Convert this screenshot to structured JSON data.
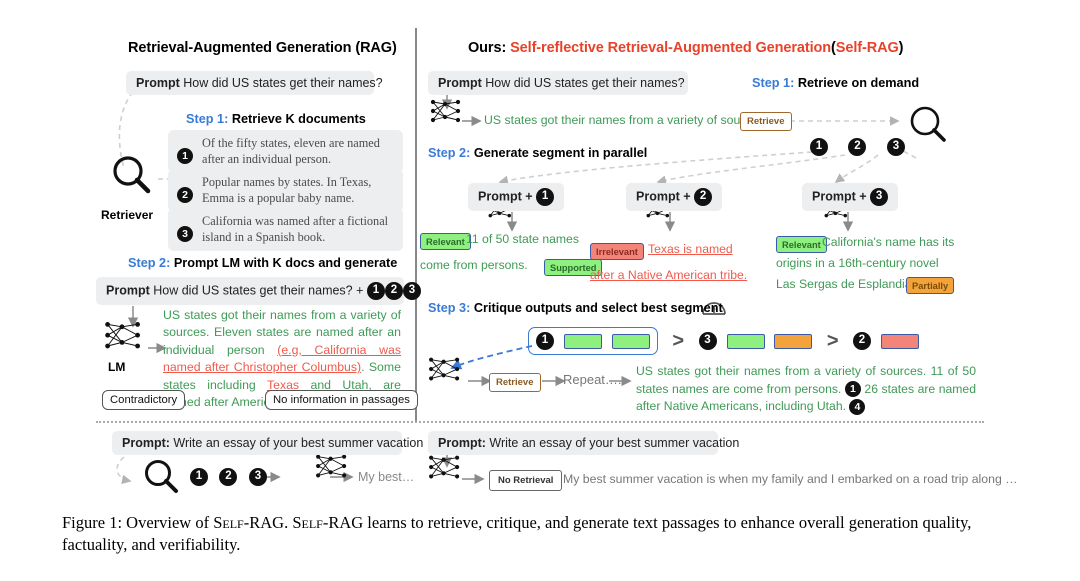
{
  "left_panel": {
    "title": "Retrieval-Augmented Generation (RAG)",
    "prompt_label": "Prompt",
    "prompt_text": "How did US states get their names?",
    "step1_num": "Step 1:",
    "step1_text": "Retrieve K documents",
    "step2_num": "Step 2:",
    "step2_text": "Prompt LM with K docs and generate",
    "retriever_label": "Retriever",
    "lm_label": "LM",
    "passages": [
      {
        "num": "1",
        "text": "Of the fifty states, eleven are named after an individual person."
      },
      {
        "num": "2",
        "text": "Popular names by states. In Texas, Emma is a popular baby name."
      },
      {
        "num": "3",
        "text": "California was named after a fictional island in a Spanish book."
      }
    ],
    "prompt2_label": "Prompt",
    "prompt2_text": "How did US states get their names? +",
    "prompt2_nums": [
      "1",
      "2",
      "3"
    ],
    "generation": {
      "good1": "US states got their names from a variety of sources. Eleven states are named after an individual person ",
      "bad1": "(e.g, California was named after Christopher Columbus)",
      "good2": ". Some states including ",
      "bad2": "Texas",
      "good3": " and Utah, are named after American tribe",
      "callout1": "Contradictory",
      "callout2": "No information in passages"
    },
    "bottom": {
      "prompt_label": "Prompt:",
      "prompt_text": "Write an essay of your best summer vacation",
      "nums": [
        "1",
        "2",
        "3"
      ],
      "output": "My best…"
    }
  },
  "right_panel": {
    "title_prefix": "Ours:",
    "title_main": "Self-reflective Retrieval-Augmented Generation",
    "title_paren_open": "(",
    "title_abbrev": "Self-RAG",
    "title_paren_close": ")",
    "prompt_label": "Prompt",
    "prompt_text": "How did US states get their names?",
    "step1_num": "Step 1:",
    "step1_text": "Retrieve on demand",
    "step2_num": "Step 2:",
    "step2_text": "Generate segment in parallel",
    "step3_num": "Step 3:",
    "step3_text": "Critique outputs and select best segment",
    "step1_output": "US states got their names from a variety of sources.",
    "retrieve_token": "Retrieve",
    "docnums": [
      "1",
      "2",
      "3"
    ],
    "branches": [
      {
        "header_prefix": "Prompt +",
        "header_num": "1",
        "rel_badge": "Relevant",
        "text_line1": "11 of 50 state names",
        "text_line2": "come from persons.",
        "sup_badge": "Supported",
        "color": "green"
      },
      {
        "header_prefix": "Prompt +",
        "header_num": "2",
        "rel_badge": "Irrelevant",
        "text_line1": "Texas is named",
        "text_line2": "after a Native American tribe.",
        "sup_badge": "",
        "color": "red"
      },
      {
        "header_prefix": "Prompt +",
        "header_num": "3",
        "rel_badge": "Relevant",
        "text_line1": "California's name has its",
        "text_line2": "origins in a 16th-century novel",
        "text_line3": "Las Sergas de Esplandián.",
        "sup_badge": "Partially",
        "color": "green"
      }
    ],
    "ranking": [
      {
        "num": "1",
        "boxes": [
          "green",
          "green"
        ],
        "selected": true
      },
      {
        "num": "3",
        "boxes": [
          "green",
          "orange"
        ],
        "selected": false
      },
      {
        "num": "2",
        "boxes": [
          "red"
        ],
        "selected": false
      }
    ],
    "rank_sep": ">",
    "repeat_label": "Repeat….",
    "retrieve_token2": "Retrieve",
    "final_output": {
      "part1": "US states got their names from a variety of sources. 11 of 50 states names are come from persons.",
      "cite1": "1",
      "part2": "26 states are named after Native Americans, including Utah.",
      "cite2": "4"
    },
    "bottom": {
      "prompt_label": "Prompt:",
      "prompt_text": "Write an essay of your best summer vacation",
      "no_retrieval_token": "No Retrieval",
      "output": "My best summer vacation is when my family and I embarked on a road trip along …"
    }
  },
  "caption": {
    "prefix": "Figure 1: Overview of ",
    "name1": "Self-RAG",
    "mid": ". ",
    "name2": "Self-RAG",
    "rest": " learns to retrieve, critique, and generate text passages to enhance overall generation quality, factuality, and verifiability."
  },
  "colors": {
    "accent_blue": "#3a7bd5",
    "accent_red": "#e8432a",
    "good_green": "#3f9a56",
    "bad_red": "#ef5a4c",
    "badge_green": "#8ef07e",
    "badge_red": "#f3847a",
    "badge_orange": "#f2a33c",
    "token_brown": "#a0682c"
  }
}
